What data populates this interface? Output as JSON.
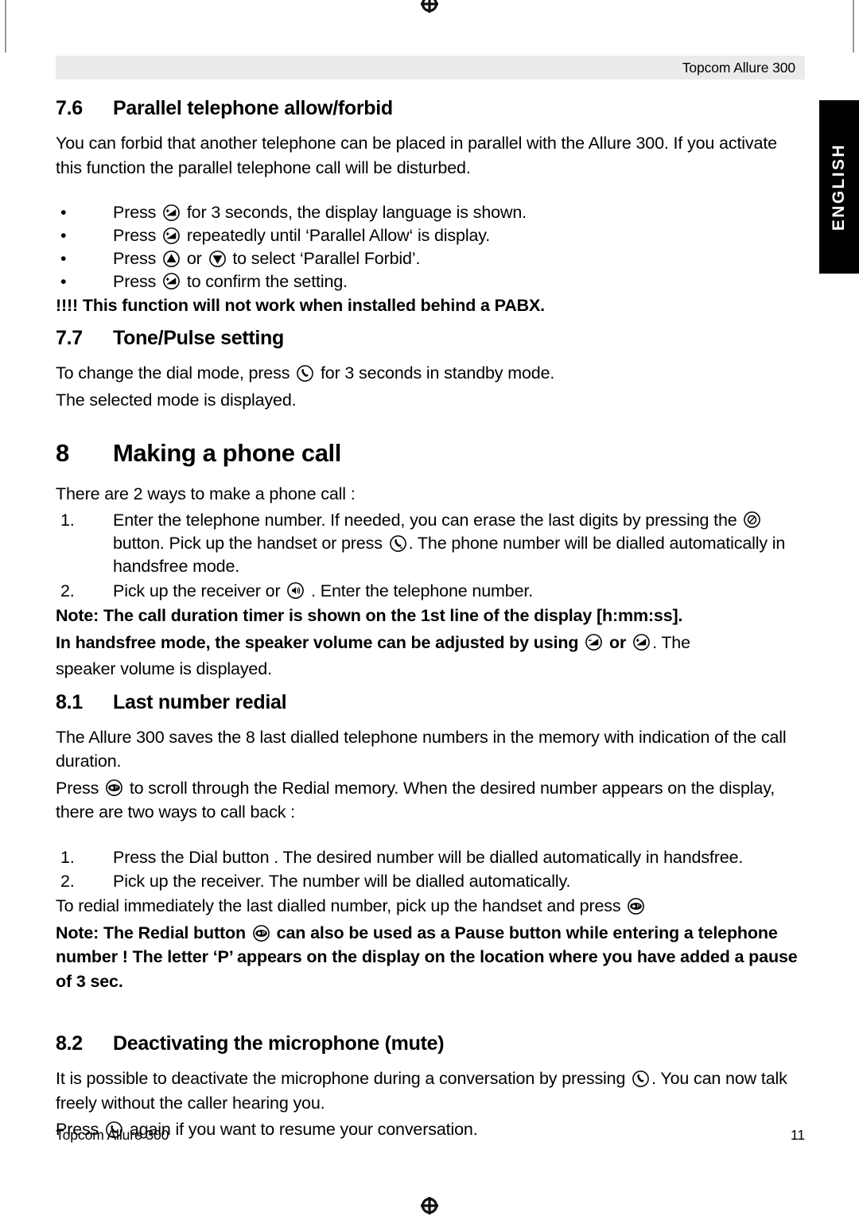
{
  "page": {
    "header_title": "Topcom Allure 300",
    "language_tab": "ENGLISH",
    "footer_left": "Topcom Allure 300",
    "footer_page": "11"
  },
  "sections": {
    "s76": {
      "number": "7.6",
      "title": "Parallel telephone allow/forbid",
      "intro": "You can forbid that another telephone can be placed in parallel with the Allure 300. If you activate this function the parallel telephone call will be disturbed.",
      "bullets": [
        {
          "marker": "•",
          "pre": "Press ",
          "icon": "volume-up-icon",
          "post": " for 3 seconds, the display language is shown."
        },
        {
          "marker": "•",
          "pre": "Press ",
          "icon": "volume-up-icon",
          "post": " repeatedly until ‘Parallel Allow‘ is display."
        },
        {
          "marker": "•",
          "pre": "Press ",
          "icon": "arrow-up-icon",
          "mid": " or ",
          "icon2": "arrow-down-icon",
          "post": "  to select ‘Parallel Forbid’."
        },
        {
          "marker": "•",
          "pre": "Press ",
          "icon": "volume-up-icon",
          "post": " to confirm the setting."
        }
      ],
      "warning": "!!!! This function will not work when installed behind a PABX."
    },
    "s77": {
      "number": "7.7",
      "title": "Tone/Pulse setting",
      "line1_pre": "To change the dial mode, press ",
      "line1_icon": "handset-icon",
      "line1_post": "  for 3 seconds in standby mode.",
      "line2": "The selected mode is displayed."
    },
    "s8": {
      "number": "8",
      "title": "Making a phone call",
      "intro": "There are  2 ways to make a phone call :",
      "items": [
        {
          "marker": "1.",
          "part1": "Enter the telephone number. If needed, you can erase the last digits by pressing the ",
          "icon1": "erase-icon",
          "part2": " button. Pick up the handset or press ",
          "icon2": "handsfree-icon",
          "part3": ". The phone number will be dialled automatically in handsfree mode."
        },
        {
          "marker": "2.",
          "part1": "Pick up the receiver or ",
          "icon1": "speaker-icon",
          "part2": " . Enter the telephone number."
        }
      ],
      "note_line1": "Note: The call duration timer is shown on the 1st line of the display [h:mm:ss].",
      "note_line2_pre": "In handsfree mode, the speaker volume can be adjusted by using ",
      "note_line2_icon1": "volume-down-icon",
      "note_line2_mid": " or ",
      "note_line2_icon2": "volume-up-icon",
      "note_line2_post": ". The",
      "note_line3": "speaker volume is displayed."
    },
    "s81": {
      "number": "8.1",
      "title": "Last number redial",
      "para1": "The Allure 300 saves the 8 last dialled telephone numbers in the memory with indication of the call duration.",
      "para2_pre": "Press ",
      "para2_icon": "redial-icon",
      "para2_post": "  to scroll through the Redial memory. When the desired number appears on the display, there are two ways to call back :",
      "items": [
        {
          "marker": "1.",
          "text": "Press the Dial button . The desired number will be dialled automatically in handsfree."
        },
        {
          "marker": "2.",
          "text": "Pick up the receiver. The number will be dialled automatically."
        }
      ],
      "para3_pre": "To redial immediately the last dialled number, pick up the handset and press ",
      "para3_icon": "redial-icon",
      "note_pre": "Note: The Redial button ",
      "note_icon": "redial-icon",
      "note_post": " can also be used as a Pause button while entering a telephone number ! The letter ‘P’ appears on the display on the location where you have added a pause of 3 sec."
    },
    "s82": {
      "number": "8.2",
      "title": "Deactivating the microphone (mute)",
      "para1_pre": "It is possible to deactivate the microphone during a conversation by pressing ",
      "para1_icon": "handset-icon",
      "para1_post": ". You can now talk freely without the caller hearing you.",
      "para2_pre": "Press ",
      "para2_icon": "handset-icon",
      "para2_post": " again if you want to resume your conversation."
    }
  },
  "colors": {
    "header_band": "#ebebeb",
    "tab_background": "#000000",
    "tab_text": "#ffffff",
    "text": "#000000"
  }
}
